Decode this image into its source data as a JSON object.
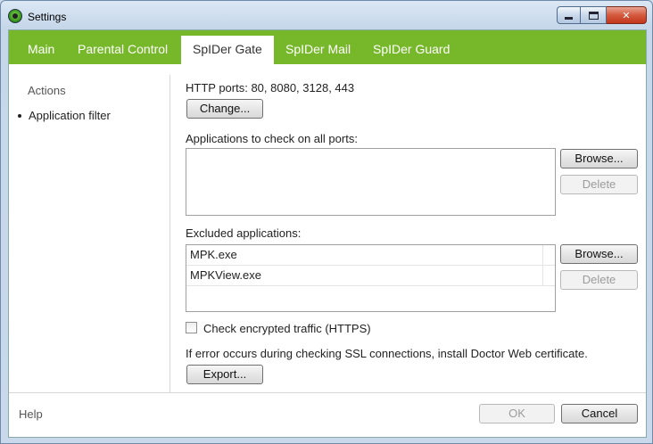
{
  "window": {
    "title": "Settings"
  },
  "tabs": [
    {
      "label": "Main",
      "active": false
    },
    {
      "label": "Parental Control",
      "active": false
    },
    {
      "label": "SpIDer Gate",
      "active": true
    },
    {
      "label": "SpIDer Mail",
      "active": false
    },
    {
      "label": "SpIDer Guard",
      "active": false
    }
  ],
  "sidebar": {
    "heading": "Actions",
    "items": [
      {
        "label": "Application filter"
      }
    ]
  },
  "gate": {
    "http_ports": "HTTP ports: 80, 8080, 3128, 443",
    "change_label": "Change...",
    "all_ports_label": "Applications to check on all ports:",
    "all_ports_apps": [],
    "browse_label": "Browse...",
    "delete_label": "Delete",
    "excluded_label": "Excluded applications:",
    "excluded_apps": [
      "MPK.exe",
      "MPKView.exe"
    ],
    "https_label": "Check encrypted traffic (HTTPS)",
    "https_checked": false,
    "ssl_note": "If error occurs during checking SSL connections, install Doctor Web certificate.",
    "export_label": "Export..."
  },
  "footer": {
    "help": "Help",
    "ok": "OK",
    "cancel": "Cancel"
  },
  "colors": {
    "tab_bar": "#77b82a",
    "close_button": "#c2361c"
  }
}
